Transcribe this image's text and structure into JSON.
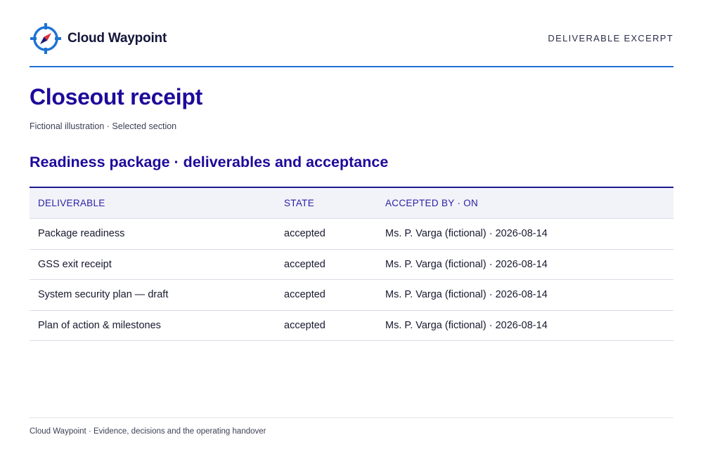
{
  "brand": {
    "name": "Cloud Waypoint",
    "icon": "compass-icon",
    "colors": {
      "blue": "#1e73d6",
      "red": "#e0313a",
      "navy": "#1d0a9a"
    }
  },
  "header": {
    "tag": "DELIVERABLE EXCERPT"
  },
  "page": {
    "title": "Closeout receipt",
    "subtitle": "Fictional illustration · Selected section"
  },
  "section": {
    "title": "Readiness package · deliverables and acceptance"
  },
  "table": {
    "columns": [
      "DELIVERABLE",
      "STATE",
      "ACCEPTED BY · ON"
    ],
    "rows": [
      [
        "Package readiness",
        "accepted",
        "Ms. P. Varga (fictional) · 2026-08-14"
      ],
      [
        "GSS exit receipt",
        "accepted",
        "Ms. P. Varga (fictional) · 2026-08-14"
      ],
      [
        "System security plan — draft",
        "accepted",
        "Ms. P. Varga (fictional) · 2026-08-14"
      ],
      [
        "Plan of action & milestones",
        "accepted",
        "Ms. P. Varga (fictional) · 2026-08-14"
      ]
    ]
  },
  "footer": {
    "text": "Cloud Waypoint · Evidence, decisions and the operating handover"
  }
}
